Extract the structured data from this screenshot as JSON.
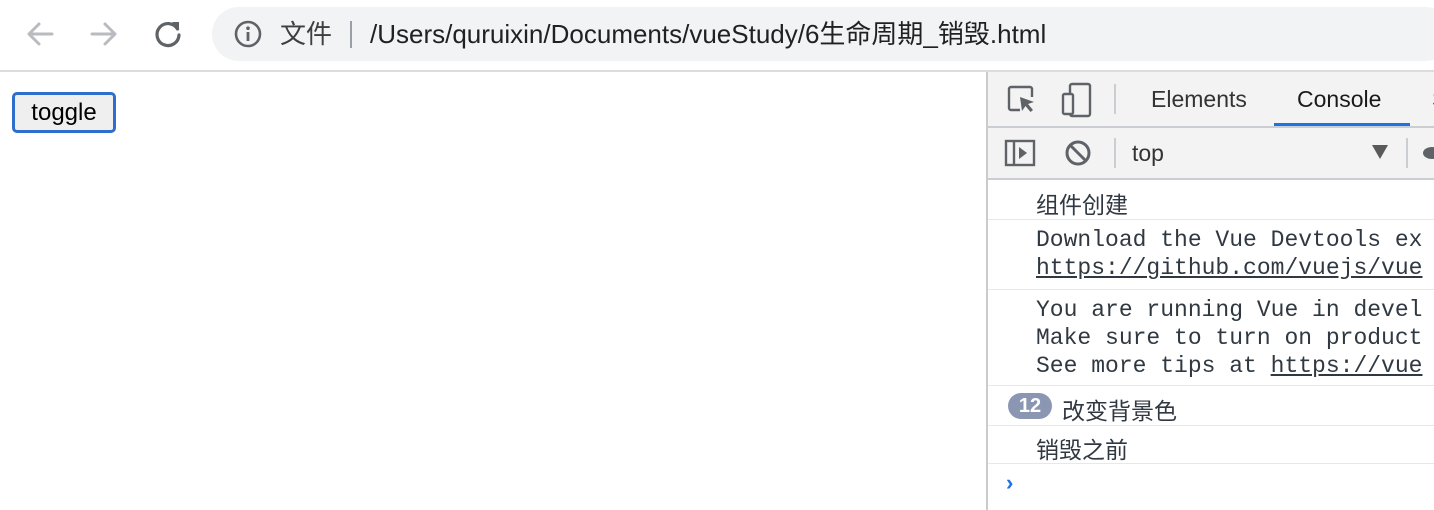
{
  "browser": {
    "back_icon": "arrow-left-icon",
    "forward_icon": "arrow-right-icon",
    "reload_icon": "reload-icon",
    "info_icon": "info-circle-icon",
    "scheme_label": "文件",
    "url": "/Users/quruixin/Documents/vueStudy/6生命周期_销毁.html"
  },
  "page": {
    "toggle_label": "toggle"
  },
  "devtools": {
    "tabs": [
      "Elements",
      "Console",
      "S"
    ],
    "active_tab": "Console",
    "context": "top",
    "messages": {
      "m1": "组件创建",
      "m2_line1": "Download the Vue Devtools ex",
      "m2_line2": "https://github.com/vuejs/vue",
      "m3_line1": "You are running Vue in devel",
      "m3_line2": "Make sure to turn on product",
      "m3_line3_prefix": "See more tips at ",
      "m3_line3_link": "https://vue",
      "m4_count": "12",
      "m4_text": "改变背景色",
      "m5": "销毁之前"
    },
    "prompt": "›"
  },
  "colors": {
    "accent": "#1a73e8",
    "badge": "#8b97b2",
    "button_border": "#2f6ecc"
  }
}
